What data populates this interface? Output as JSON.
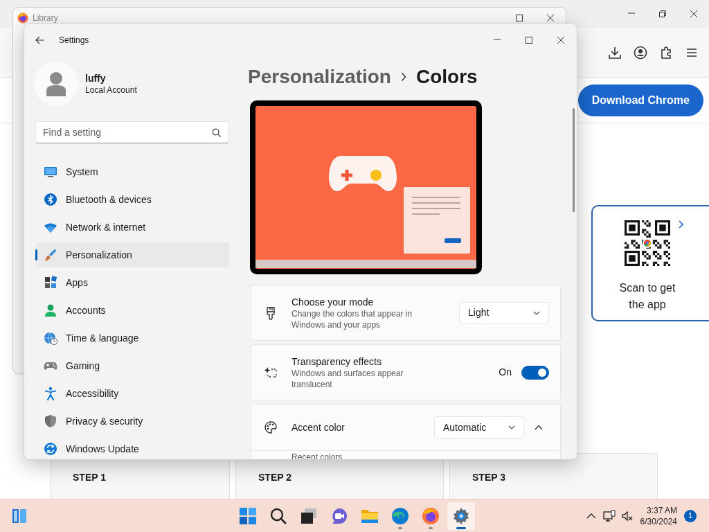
{
  "browser": {
    "download_button": "Download Chrome",
    "qr_caption": "Scan to get the app",
    "steps": [
      "STEP 1",
      "STEP 2",
      "STEP 3"
    ]
  },
  "library_window": {
    "title": "Library"
  },
  "settings_window": {
    "title": "Settings",
    "user": {
      "name": "luffy",
      "account_type": "Local Account"
    },
    "search": {
      "placeholder": "Find a setting"
    },
    "nav_items": [
      {
        "label": "System",
        "selected": false
      },
      {
        "label": "Bluetooth & devices",
        "selected": false
      },
      {
        "label": "Network & internet",
        "selected": false
      },
      {
        "label": "Personalization",
        "selected": true
      },
      {
        "label": "Apps",
        "selected": false
      },
      {
        "label": "Accounts",
        "selected": false
      },
      {
        "label": "Time & language",
        "selected": false
      },
      {
        "label": "Gaming",
        "selected": false
      },
      {
        "label": "Accessibility",
        "selected": false
      },
      {
        "label": "Privacy & security",
        "selected": false
      },
      {
        "label": "Windows Update",
        "selected": false
      }
    ],
    "breadcrumb": [
      "Personalization",
      "Colors"
    ],
    "cards": [
      {
        "kind": "dropdown",
        "title": "Choose your mode",
        "description": "Change the colors that appear in Windows and your apps",
        "value": "Light"
      },
      {
        "kind": "toggle",
        "title": "Transparency effects",
        "description": "Windows and surfaces appear translucent",
        "state_label": "On",
        "on": true
      },
      {
        "kind": "expander",
        "title": "Accent color",
        "value": "Automatic",
        "expanded": true,
        "section": "Recent colors"
      }
    ]
  },
  "taskbar": {
    "apps": [
      {
        "running": false,
        "selected": false
      },
      {
        "running": false,
        "selected": false
      },
      {
        "running": false,
        "selected": false
      },
      {
        "running": false,
        "selected": false
      },
      {
        "running": false,
        "selected": false
      },
      {
        "running": true,
        "selected": false
      },
      {
        "running": true,
        "selected": false
      },
      {
        "running": true,
        "selected": true
      }
    ],
    "time": "3:37 AM",
    "date": "6/30/2024",
    "notification_count": "1"
  }
}
